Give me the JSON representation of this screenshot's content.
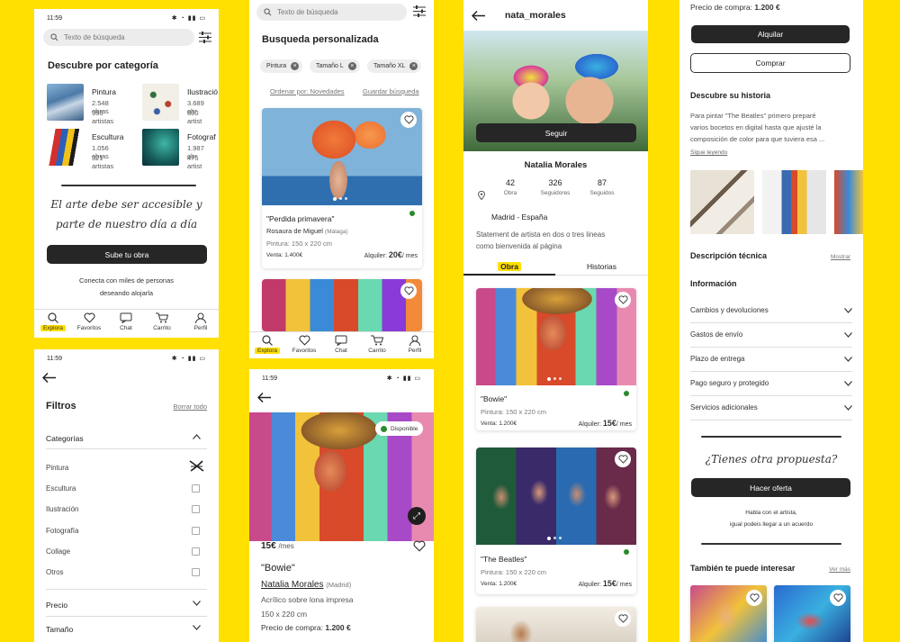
{
  "status_time": "11:59",
  "s1": {
    "search_placeholder": "Texto de búsqueda",
    "title": "Descubre por categoría",
    "categories": [
      {
        "name": "Pintura",
        "works": "2.548 obras",
        "artists": "956 artistas"
      },
      {
        "name": "Ilustració",
        "works": "3.689 obr",
        "artists": "600 artist"
      },
      {
        "name": "Escultura",
        "works": "1.056 obras",
        "artists": "321 artistas"
      },
      {
        "name": "Fotograf",
        "works": "1.987 obr",
        "artists": "475 artist"
      }
    ],
    "slogan_line1": "El arte debe ser accesible y",
    "slogan_line2": "parte de nuestro día a día",
    "cta": "Sube tu obra",
    "sub1": "Conecta con miles de personas",
    "sub2": "deseando alojarla"
  },
  "tabbar": {
    "explora": "Explora",
    "favoritos": "Favoritos",
    "chat": "Chat",
    "carrito": "Carrito",
    "perfil": "Perfil"
  },
  "s2": {
    "search_placeholder": "Texto de búsqueda",
    "title": "Busqueda personalizada",
    "chips": [
      "Pintura",
      "Tamaño L",
      "Tamaño XL"
    ],
    "sort": "Ordenar por: Novedades",
    "save": "Guardar búsqueda",
    "card_title": "\"Perdida primavera\"",
    "artist": "Rosaura de Miguel",
    "location": "(Málaga)",
    "specs": "Pintura: 150 x 220 cm",
    "sale": "Venta: 1.400€",
    "rent_label": "Alquiler:",
    "rent_price": "20€",
    "rent_unit": "/ mes"
  },
  "s3": {
    "title": "Filtros",
    "clear": "Borrar todo",
    "section": "Categorías",
    "options": [
      "Pintura",
      "Escultura",
      "Ilustración",
      "Fotografía",
      "Collage",
      "Otros"
    ],
    "price": "Precio",
    "size": "Tamaño"
  },
  "s4": {
    "badge": "Disponible",
    "price": "15€",
    "per": "/mes",
    "title": "\"Bowie\"",
    "artist": "Natalia Morales",
    "location": "(Madrid)",
    "medium": "Acrílico sobre lona impresa",
    "size": "150 x 220 cm",
    "buy_label": "Precio de compra:",
    "buy_price": "1.200 €"
  },
  "s5": {
    "username": "nata_morales",
    "follow": "Seguir",
    "name": "Natalia Morales",
    "stats": [
      {
        "n": "42",
        "l": "Obra"
      },
      {
        "n": "326",
        "l": "Seguidores"
      },
      {
        "n": "87",
        "l": "Seguidos"
      }
    ],
    "location": "Madrid - España",
    "bio1": "Statement de artista en dos o tres lineas",
    "bio2": "como bienvenida al página",
    "tab_obra": "Obra",
    "tab_hist": "Historias",
    "card1": {
      "title": "\"Bowie\"",
      "specs": "Pintura: 150 x 220 cm",
      "sale": "Venta: 1.200€",
      "rent_label": "Alquiler:",
      "rent_price": "15€",
      "rent_unit": "/ mes"
    },
    "card2": {
      "title": "\"The Beatles\"",
      "specs": "Pintura: 150 x 220 cm",
      "sale": "Venta: 1.200€",
      "rent_label": "Alquiler:",
      "rent_price": "15€",
      "rent_unit": "/ mes"
    }
  },
  "s6": {
    "buy_label": "Precio de compra:",
    "buy_price": "1.200 €",
    "rent_btn": "Alquilar",
    "buy_btn": "Comprar",
    "story_title": "Descubre su historia",
    "story1": "Para pintar \"The Beatles\" primero preparé",
    "story2": "varios bocetos en digital hasta que ajusté la",
    "story3": "composición de color para que tuviera esa ...",
    "read_more": "Sigue leyendo",
    "tech": "Descripción técnica",
    "show": "Mostrar",
    "info": "Información",
    "info_rows": [
      "Cambios y devoluciones",
      "Gastos de envío",
      "Plazo de entrega",
      "Pago seguro y protegido",
      "Servicios adicionales"
    ],
    "proposal": "¿Tienes otra propuesta?",
    "offer_btn": "Hacer oferta",
    "talk1": "Habla con el artista,",
    "talk2": "igual podeis llegar a un acuerdo",
    "also": "También te puede interesar",
    "see_more": "Ver más"
  },
  "colors": {
    "accent": "#ffe000",
    "dark_button": "#262626",
    "available": "#2c8a2c"
  }
}
